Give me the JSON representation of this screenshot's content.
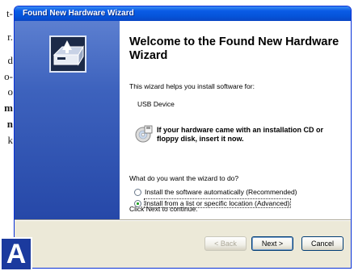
{
  "document": {
    "fragments": [
      {
        "text": "t-",
        "bold": false
      },
      {
        "text": "r.",
        "bold": false
      },
      {
        "text": "d",
        "bold": false
      },
      {
        "text": "o-",
        "bold": false
      },
      {
        "text": "o",
        "bold": false
      },
      {
        "text": "m",
        "bold": true
      },
      {
        "text": "n",
        "bold": true
      },
      {
        "text": "k",
        "bold": false
      }
    ]
  },
  "window": {
    "title": "Found New Hardware Wizard"
  },
  "wizard": {
    "heading": "Welcome to the Found New Hardware Wizard",
    "intro": "This wizard helps you install software for:",
    "device": "USB Device",
    "cd_prompt": "If your hardware came with an installation CD or floppy disk, insert it now.",
    "question": "What do you want the wizard to do?",
    "options": [
      {
        "label": "Install the software automatically (Recommended)",
        "selected": false
      },
      {
        "label": "Install from a list or specific location (Advanced)",
        "selected": true
      }
    ],
    "continue_text": "Click Next to continue."
  },
  "buttons": {
    "back": "< Back",
    "next": "Next >",
    "cancel": "Cancel"
  },
  "figure_label": "A",
  "colors": {
    "title_bar": "#0a5ce6",
    "side_panel": "#3d62bd",
    "badge": "#1b3a9e"
  },
  "icons": {
    "wizard": "hardware-wizard-icon",
    "cd": "cd-icon"
  }
}
